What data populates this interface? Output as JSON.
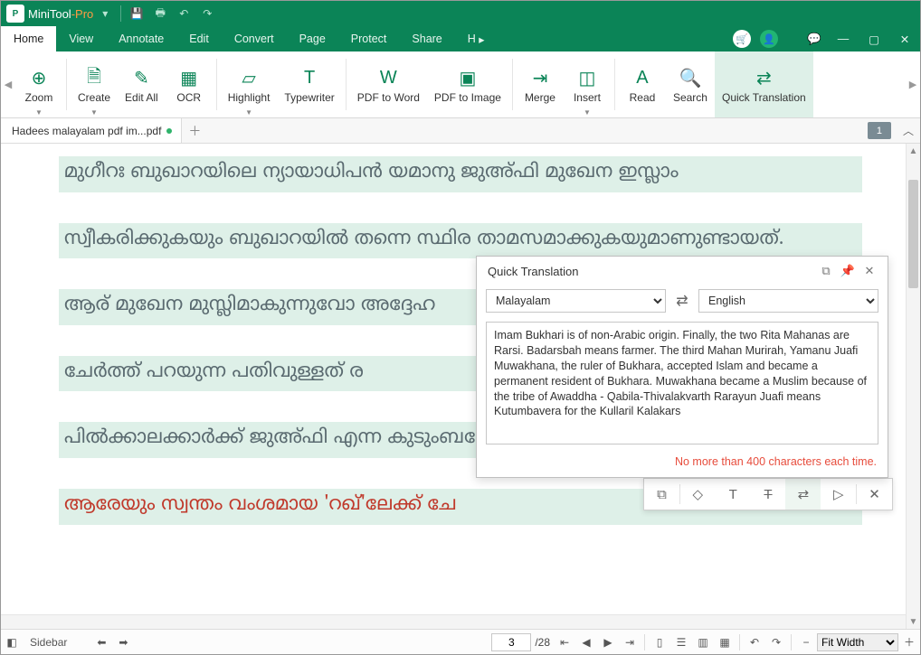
{
  "title": {
    "brand": "MiniTool",
    "suffix": "-Pro"
  },
  "menu": {
    "items": [
      "Home",
      "View",
      "Annotate",
      "Edit",
      "Convert",
      "Page",
      "Protect",
      "Share",
      "H"
    ],
    "active": 0
  },
  "ribbon": {
    "tools": [
      {
        "label": "Zoom",
        "dd": true,
        "icon": "⊕"
      },
      {
        "label": "Create",
        "dd": true,
        "icon": "🗎"
      },
      {
        "label": "Edit All",
        "dd": false,
        "icon": "✎"
      },
      {
        "label": "OCR",
        "dd": false,
        "icon": "▦"
      },
      {
        "label": "Highlight",
        "dd": true,
        "icon": "▱"
      },
      {
        "label": "Typewriter",
        "dd": false,
        "icon": "T"
      },
      {
        "label": "PDF to Word",
        "dd": false,
        "icon": "W"
      },
      {
        "label": "PDF to Image",
        "dd": false,
        "icon": "▣"
      },
      {
        "label": "Merge",
        "dd": false,
        "icon": "⇥"
      },
      {
        "label": "Insert",
        "dd": true,
        "icon": "◫"
      },
      {
        "label": "Read",
        "dd": false,
        "icon": "A"
      },
      {
        "label": "Search",
        "dd": false,
        "icon": "🔍"
      },
      {
        "label": "Quick Translation",
        "dd": false,
        "icon": "⇄",
        "active": true
      }
    ]
  },
  "tab": {
    "name": "Hadees malayalam pdf im...pdf",
    "badge": "1"
  },
  "doc": {
    "lines": [
      "മുഗീറഃ    ബുഖാറയിലെ    ന്യായാധിപൻ    യമാനു    ജുഅ്ഫി    മുഖേന    ഇസ്ലാം",
      "സ്വീകരിക്കുകയും ബുഖാറയിൽ തന്നെ സ്ഥിര താമസമാക്കുകയുമാണുണ്ടായത്.",
      "ആര് മുഖേന മുസ്ലിമാകുന്നുവോ അദ്ദേഹ",
      "ചേർത്ത്     പറയുന്ന     പതിവുള്ളത്     ര",
      "പിൽക്കാലക്കാർക്ക് ജുഅ്ഫി എന്ന കുടുംബഫേ",
      "ആരേയും സ്വന്തം വംശമായ 'റഖ്'ലേക്ക് ചേ"
    ]
  },
  "qt": {
    "title": "Quick Translation",
    "from": "Malayalam",
    "to": "English",
    "text": "Imam Bukhari is of non-Arabic origin. Finally, the two Rita Mahanas are Rarsi. Badarsbah means farmer. The third Mahan Murirah, Yamanu Juafi Muwakhana, the ruler of Bukhara, accepted Islam and became a permanent resident of Bukhara. Muwakhana became a Muslim because of the tribe of Awaddha - Qabila-Thivalakvarth Rarayun Juafi means Kutumbavera for the Kullaril Kalakars",
    "footer": "No more than 400 characters each time."
  },
  "status": {
    "sidebar": "Sidebar",
    "page": "3",
    "total": "/28",
    "zoom": "Fit Width"
  }
}
